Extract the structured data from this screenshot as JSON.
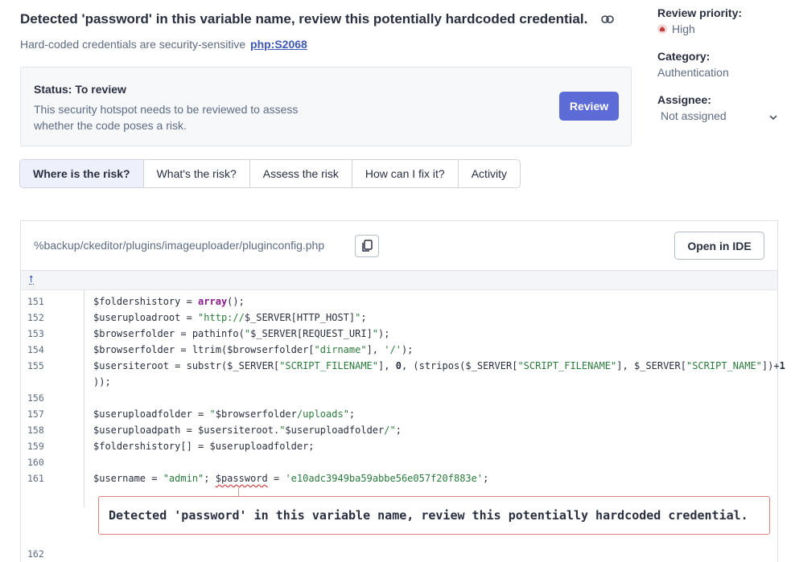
{
  "header": {
    "title": "Detected 'password' in this variable name, review this potentially hardcoded credential.",
    "subtitle": "Hard-coded credentials are security-sensitive",
    "rule_key": "php:S2068"
  },
  "status": {
    "title": "Status: To review",
    "description": "This security hotspot needs to be reviewed to assess whether the code poses a risk.",
    "review_label": "Review"
  },
  "side": {
    "priority_label": "Review priority:",
    "priority_value": "High",
    "category_label": "Category:",
    "category_value": "Authentication",
    "assignee_label": "Assignee:",
    "assignee_value": "Not assigned"
  },
  "tabs": [
    {
      "label": "Where is the risk?",
      "active": true
    },
    {
      "label": "What's the risk?"
    },
    {
      "label": "Assess the risk"
    },
    {
      "label": "How can I fix it?"
    },
    {
      "label": "Activity"
    }
  ],
  "code": {
    "file_path": "%backup/ckeditor/plugins/imageuploader/pluginconfig.php",
    "open_ide_label": "Open in IDE",
    "line_numbers": [
      "151",
      "152",
      "153",
      "154",
      "155",
      "156",
      "157",
      "158",
      "159",
      "160",
      "161",
      "162"
    ],
    "hotspot_message": "Detected 'password' in this variable name, review this potentially hardcoded credential."
  },
  "colors": {
    "accent": "#5d6bd6",
    "link": "#3d57b5",
    "high_priority": "#c23b3b",
    "hotspot_border": "#e07d7d"
  }
}
